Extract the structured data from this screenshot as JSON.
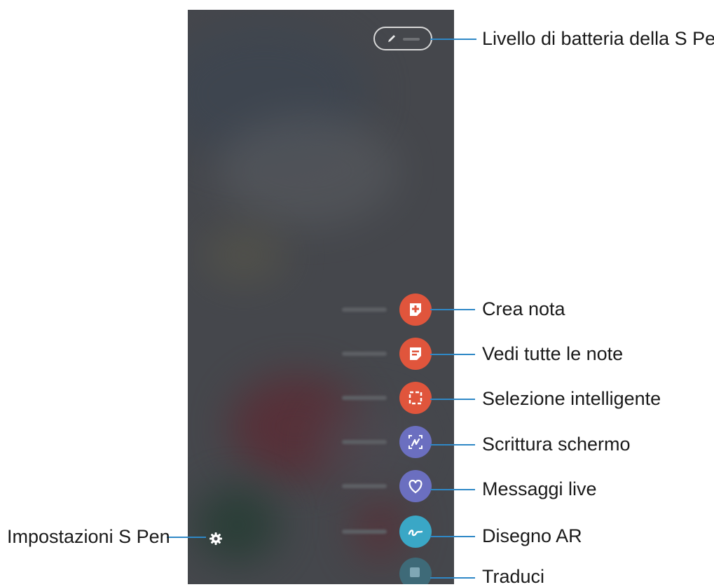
{
  "phone": {
    "battery_icon": "pen-icon",
    "settings_icon": "gear-icon"
  },
  "commands": [
    {
      "name": "create-note",
      "icon": "note-plus-icon",
      "color": "#e0553c",
      "callout": "Crea nota"
    },
    {
      "name": "view-all-notes",
      "icon": "note-list-icon",
      "color": "#e0553c",
      "callout": "Vedi tutte le note"
    },
    {
      "name": "smart-select",
      "icon": "dashed-select-icon",
      "color": "#e0553c",
      "callout": "Selezione intelligente"
    },
    {
      "name": "screen-write",
      "icon": "screen-write-icon",
      "color": "#6b6fc0",
      "callout": "Scrittura schermo"
    },
    {
      "name": "live-messages",
      "icon": "heart-icon",
      "color": "#6b6fc0",
      "callout": "Messaggi live"
    },
    {
      "name": "ar-doodle",
      "icon": "squiggle-icon",
      "color": "#3aa7c6",
      "callout": "Disegno AR"
    },
    {
      "name": "translate",
      "icon": "translate-icon",
      "color": "#3aa7c6",
      "callout": "Traduci"
    }
  ],
  "callouts": {
    "battery": "Livello di batteria della S Pen",
    "settings": "Impostazioni S Pen"
  },
  "colors": {
    "callout_line": "#2f88c6",
    "orange": "#e0553c",
    "purple": "#6b6fc0",
    "teal": "#3aa7c6"
  }
}
